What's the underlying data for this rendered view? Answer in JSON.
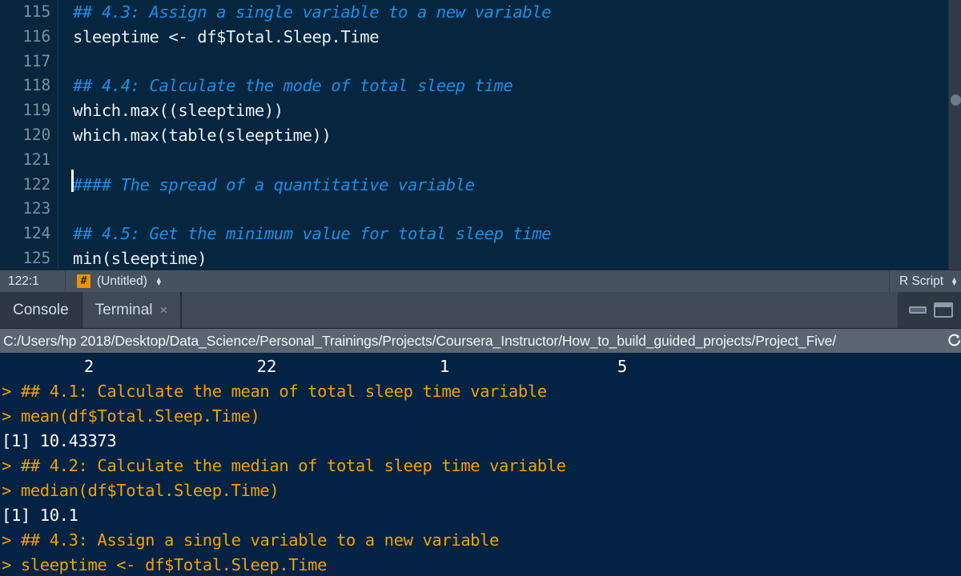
{
  "editor": {
    "lines": [
      {
        "number": "115",
        "text": "## 4.3: Assign a single variable to a new variable",
        "type": "comment"
      },
      {
        "number": "116",
        "text": "sleeptime <- df$Total.Sleep.Time",
        "type": "code"
      },
      {
        "number": "117",
        "text": "",
        "type": "code"
      },
      {
        "number": "118",
        "text": "## 4.4: Calculate the mode of total sleep time",
        "type": "comment"
      },
      {
        "number": "119",
        "text": "which.max((sleeptime))",
        "type": "code"
      },
      {
        "number": "120",
        "text": "which.max(table(sleeptime))",
        "type": "code"
      },
      {
        "number": "121",
        "text": "",
        "type": "code"
      },
      {
        "number": "122",
        "text": "#### The spread of a quantitative variable",
        "type": "comment"
      },
      {
        "number": "123",
        "text": "",
        "type": "code"
      },
      {
        "number": "124",
        "text": "## 4.5: Get the minimum value for total sleep time",
        "type": "comment"
      },
      {
        "number": "125",
        "text": "min(sleeptime)",
        "type": "code"
      }
    ]
  },
  "status_bar": {
    "cursor_position": "122:1",
    "scope_badge": "#",
    "scope_label": "(Untitled)",
    "file_type": "R Script"
  },
  "console_tabs": [
    {
      "label": "Console",
      "active": true,
      "closable": false
    },
    {
      "label": "Terminal",
      "active": false,
      "closable": true,
      "close_glyph": "×"
    }
  ],
  "pane_controls": {
    "minimize_label": "minimize-pane",
    "maximize_label": "maximize-pane"
  },
  "path_bar": {
    "path": "C:/Users/hp 2018/Desktop/Data_Science/Personal_Trainings/Projects/Coursera_Instructor/How_to_build_guided_projects/Project_Five/"
  },
  "console": {
    "table_values": [
      "2",
      "22",
      "1",
      "5"
    ],
    "lines": [
      {
        "text": "> ## 4.1: Calculate the mean of total sleep time variable",
        "type": "input"
      },
      {
        "text": "> mean(df$Total.Sleep.Time)",
        "type": "input"
      },
      {
        "text": "[1] 10.43373",
        "type": "output"
      },
      {
        "text": "> ## 4.2: Calculate the median of total sleep time variable",
        "type": "input"
      },
      {
        "text": "> median(df$Total.Sleep.Time)",
        "type": "input"
      },
      {
        "text": "[1] 10.1",
        "type": "output"
      },
      {
        "text": "> ## 4.3: Assign a single variable to a new variable",
        "type": "input"
      },
      {
        "text": "> sleeptime <- df$Total.Sleep.Time",
        "type": "input"
      }
    ]
  },
  "colors": {
    "editor_background": "#06263f",
    "console_background": "#042244",
    "comment": "#1a8fe8",
    "code_text": "#e8eef3",
    "console_input": "#f0a202",
    "console_output": "#ffffff",
    "status_bar": "#46525e",
    "tab_strip": "#2d3842",
    "path_bar": "#5a6570",
    "badge_orange": "#e8930c"
  }
}
